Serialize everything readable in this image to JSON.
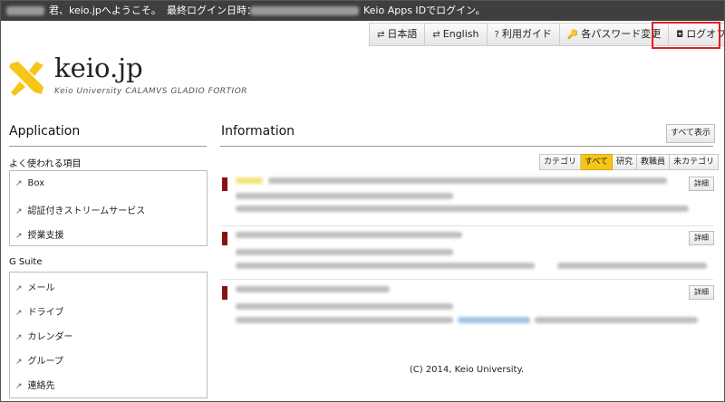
{
  "topbar": {
    "greeting_suffix": "君、keio.jpへようこそ。",
    "last_login_label": "最終ログイン日時：",
    "login_method": "Keio Apps IDでログイン。"
  },
  "nav": [
    {
      "icon": "⇄",
      "label": "日本語"
    },
    {
      "icon": "⇄",
      "label": "English"
    },
    {
      "icon": "?",
      "label": "利用ガイド"
    },
    {
      "icon": "🔑",
      "label": "各パスワード変更"
    },
    {
      "icon": "◘",
      "label": "ログオフ"
    }
  ],
  "logo": {
    "title": "keio.jp",
    "subtitle": "Keio University CALAMVS GLADIO FORTIOR"
  },
  "application": {
    "heading": "Application",
    "favorites_label": "よく使われる項目",
    "favorites": [
      "Box",
      "認証付きストリームサービス",
      "授業支援"
    ],
    "gsuite_label": "G Suite",
    "gsuite": [
      "メール",
      "ドライブ",
      "カレンダー",
      "グループ",
      "連絡先"
    ]
  },
  "information": {
    "heading": "Information",
    "show_all": "すべて表示",
    "filters": [
      "カテゴリ",
      "すべて",
      "研究",
      "教職員",
      "未カテゴリ"
    ],
    "active_filter": "すべて",
    "detail_label": "詳細"
  },
  "footer": "(C) 2014, Keio University.",
  "colors": {
    "accent": "#f5c518",
    "topbar": "#3f3f3f",
    "marker": "#8b1010",
    "highlight": "#e02020"
  }
}
